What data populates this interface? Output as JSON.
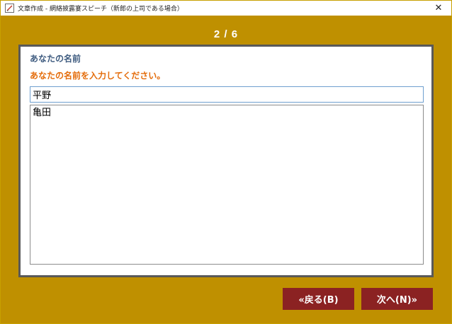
{
  "window": {
    "title": "文章作成 - 網絡披露宴スピーチ（新郎の上司である場合）",
    "close_glyph": "✕"
  },
  "wizard": {
    "page_counter": "2 / 6",
    "section_title": "あなたの名前",
    "instruction": "あなたの名前を入力してください。",
    "name_value": "平野",
    "suggestions": [
      "亀田"
    ]
  },
  "buttons": {
    "back_label": "«戻る(B)",
    "next_label": "次へ(N)»"
  },
  "colors": {
    "background": "#bf9000",
    "section_title": "#3f5c80",
    "instruction": "#e46c0a",
    "button": "#8b2222"
  },
  "icons": {
    "app": "document-edit-icon",
    "close": "close-icon"
  }
}
